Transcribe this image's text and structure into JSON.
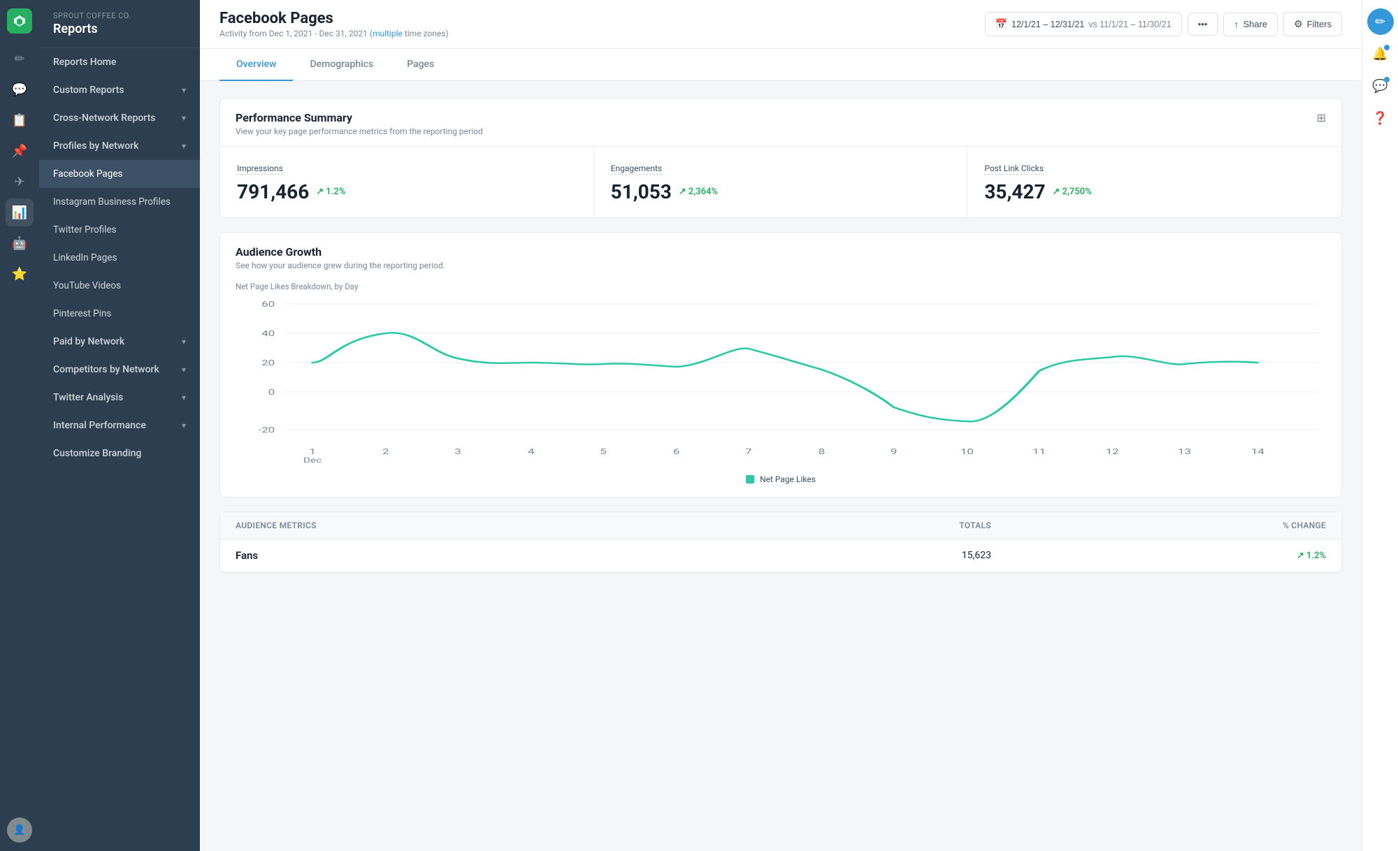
{
  "app": {
    "company": "Sprout Coffee Co.",
    "section": "Reports"
  },
  "sidebar": {
    "items": [
      {
        "id": "reports-home",
        "label": "Reports Home",
        "active": false,
        "has_sub": false
      },
      {
        "id": "custom-reports",
        "label": "Custom Reports",
        "active": false,
        "has_sub": true
      },
      {
        "id": "cross-network",
        "label": "Cross-Network Reports",
        "active": false,
        "has_sub": true
      },
      {
        "id": "profiles-by-network",
        "label": "Profiles by Network",
        "active": false,
        "has_sub": true
      },
      {
        "id": "facebook-pages",
        "label": "Facebook Pages",
        "active": true,
        "sub": true
      },
      {
        "id": "instagram",
        "label": "Instagram Business Profiles",
        "active": false,
        "sub": true
      },
      {
        "id": "twitter-profiles",
        "label": "Twitter Profiles",
        "active": false,
        "sub": true
      },
      {
        "id": "linkedin",
        "label": "LinkedIn Pages",
        "active": false,
        "sub": true
      },
      {
        "id": "youtube",
        "label": "YouTube Videos",
        "active": false,
        "sub": true
      },
      {
        "id": "pinterest",
        "label": "Pinterest Pins",
        "active": false,
        "sub": true
      },
      {
        "id": "paid-by-network",
        "label": "Paid by Network",
        "active": false,
        "has_sub": true
      },
      {
        "id": "competitors",
        "label": "Competitors by Network",
        "active": false,
        "has_sub": true
      },
      {
        "id": "twitter-analysis",
        "label": "Twitter Analysis",
        "active": false,
        "has_sub": true
      },
      {
        "id": "internal-performance",
        "label": "Internal Performance",
        "active": false,
        "has_sub": true
      },
      {
        "id": "customize-branding",
        "label": "Customize Branding",
        "active": false,
        "has_sub": false
      }
    ]
  },
  "header": {
    "page_title": "Facebook Pages",
    "date_range": "12/1/21 – 12/31/21",
    "compare_range": "vs 11/1/21 – 11/30/21",
    "subtitle": "Activity from Dec 1, 2021 - Dec 31, 2021 (",
    "subtitle_link": "multiple",
    "subtitle_end": " time zones)",
    "share_label": "Share",
    "filters_label": "Filters"
  },
  "tabs": [
    {
      "id": "overview",
      "label": "Overview",
      "active": true
    },
    {
      "id": "demographics",
      "label": "Demographics",
      "active": false
    },
    {
      "id": "pages",
      "label": "Pages",
      "active": false
    }
  ],
  "performance_summary": {
    "title": "Performance Summary",
    "subtitle": "View your key page performance metrics from the reporting period",
    "metrics": [
      {
        "label": "Impressions",
        "value": "791,466",
        "change": "1.2%"
      },
      {
        "label": "Engagements",
        "value": "51,053",
        "change": "2,364%"
      },
      {
        "label": "Post Link Clicks",
        "value": "35,427",
        "change": "2,750%"
      }
    ]
  },
  "audience_growth": {
    "title": "Audience Growth",
    "subtitle": "See how your audience grew during the reporting period.",
    "chart_label": "Net Page Likes Breakdown, by Day",
    "y_axis": [
      "60",
      "40",
      "20",
      "0",
      "-20"
    ],
    "x_axis": [
      "1\nDec",
      "2",
      "3",
      "4",
      "5",
      "6",
      "7",
      "8",
      "9",
      "10",
      "11",
      "12",
      "13",
      "14"
    ],
    "legend_label": "Net Page Likes"
  },
  "audience_metrics": {
    "title": "Audience Metrics",
    "columns": [
      "",
      "Totals",
      "% Change"
    ],
    "rows": [
      {
        "label": "Fans",
        "total": "15,623",
        "change": "1.2%"
      }
    ]
  },
  "colors": {
    "accent": "#3498db",
    "green": "#27ae60",
    "teal": "#2dc8a8",
    "sidebar_bg": "#2c3e50",
    "sidebar_active": "#3d5166"
  }
}
